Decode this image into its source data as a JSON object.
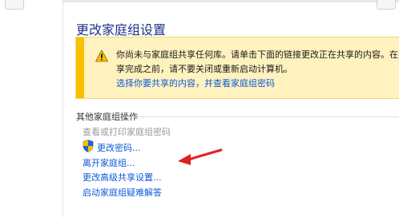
{
  "page": {
    "title": "更改家庭组设置"
  },
  "warning": {
    "message": "你尚未与家庭组共享任何库。请单击下面的链接更改正在共享的内容。在共享完成之前，请不要关闭或重新启动计算机。",
    "link_label": "选择你要共享的内容，并查看家庭组密码",
    "icon": "warning-triangle-icon"
  },
  "other_actions": {
    "heading": "其他家庭组操作",
    "items": [
      {
        "label": "查看或打印家庭组密码",
        "state": "disabled"
      },
      {
        "label": "更改密码...",
        "icon": "uac-shield-icon"
      },
      {
        "label": "离开家庭组..."
      },
      {
        "label": "更改高级共享设置..."
      },
      {
        "label": "启动家庭组疑难解答"
      }
    ]
  },
  "colors": {
    "link": "#0c5ad8",
    "title": "#1e3287",
    "warning_bg": "#fff2bf",
    "warning_stripe": "#f7c100",
    "annotation_arrow": "#e02020"
  }
}
